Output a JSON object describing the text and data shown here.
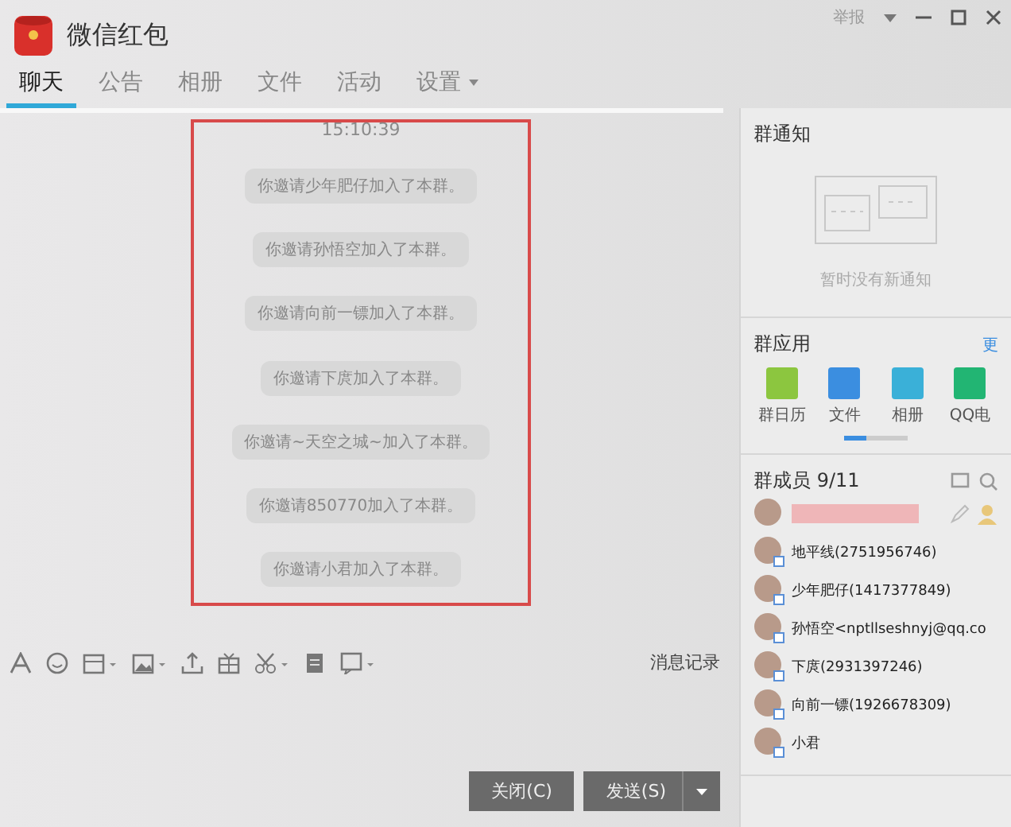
{
  "window": {
    "title": "微信红包",
    "report": "举报"
  },
  "tabs": [
    {
      "label": "聊天",
      "selected": true,
      "dropdown": false
    },
    {
      "label": "公告",
      "selected": false,
      "dropdown": false
    },
    {
      "label": "相册",
      "selected": false,
      "dropdown": false
    },
    {
      "label": "文件",
      "selected": false,
      "dropdown": false
    },
    {
      "label": "活动",
      "selected": false,
      "dropdown": false
    },
    {
      "label": "设置",
      "selected": false,
      "dropdown": true
    }
  ],
  "chat": {
    "timestamp": "15:10:39",
    "messages": [
      "你邀请少年肥仔加入了本群。",
      "你邀请孙悟空加入了本群。",
      "你邀请向前一镖加入了本群。",
      "你邀请下庹加入了本群。",
      "你邀请~天空之城~加入了本群。",
      "你邀请850770加入了本群。",
      "你邀请小君加入了本群。"
    ]
  },
  "toolbar": {
    "tools": [
      {
        "kind": "font"
      },
      {
        "kind": "emoji"
      },
      {
        "kind": "card"
      },
      {
        "kind": "image"
      },
      {
        "kind": "upload"
      },
      {
        "kind": "gift"
      },
      {
        "kind": "scissors"
      },
      {
        "kind": "document"
      },
      {
        "kind": "chat"
      }
    ],
    "history": "消息记录"
  },
  "buttons": {
    "close": "关闭(C)",
    "send": "发送(S)"
  },
  "notice": {
    "title": "群通知",
    "empty": "暂时没有新通知"
  },
  "apps": {
    "title": "群应用",
    "more": "更",
    "items": [
      {
        "label": "群日历",
        "kind": "calendar"
      },
      {
        "label": "文件",
        "kind": "folder"
      },
      {
        "label": "相册",
        "kind": "photo"
      },
      {
        "label": "QQ电",
        "kind": "phone"
      }
    ]
  },
  "members": {
    "title": "群成员 9/11",
    "items": [
      {
        "kind": "owner"
      },
      {
        "name": "地平线(2751956746)",
        "kind": "member"
      },
      {
        "name": "少年肥仔(1417377849)",
        "kind": "member"
      },
      {
        "name": "孙悟空<nptllseshnyj@qq.co",
        "kind": "member"
      },
      {
        "name": "下庹(2931397246)",
        "kind": "member"
      },
      {
        "name": "向前一镖(1926678309)",
        "kind": "member"
      },
      {
        "name": "小君",
        "kind": "member"
      }
    ]
  }
}
